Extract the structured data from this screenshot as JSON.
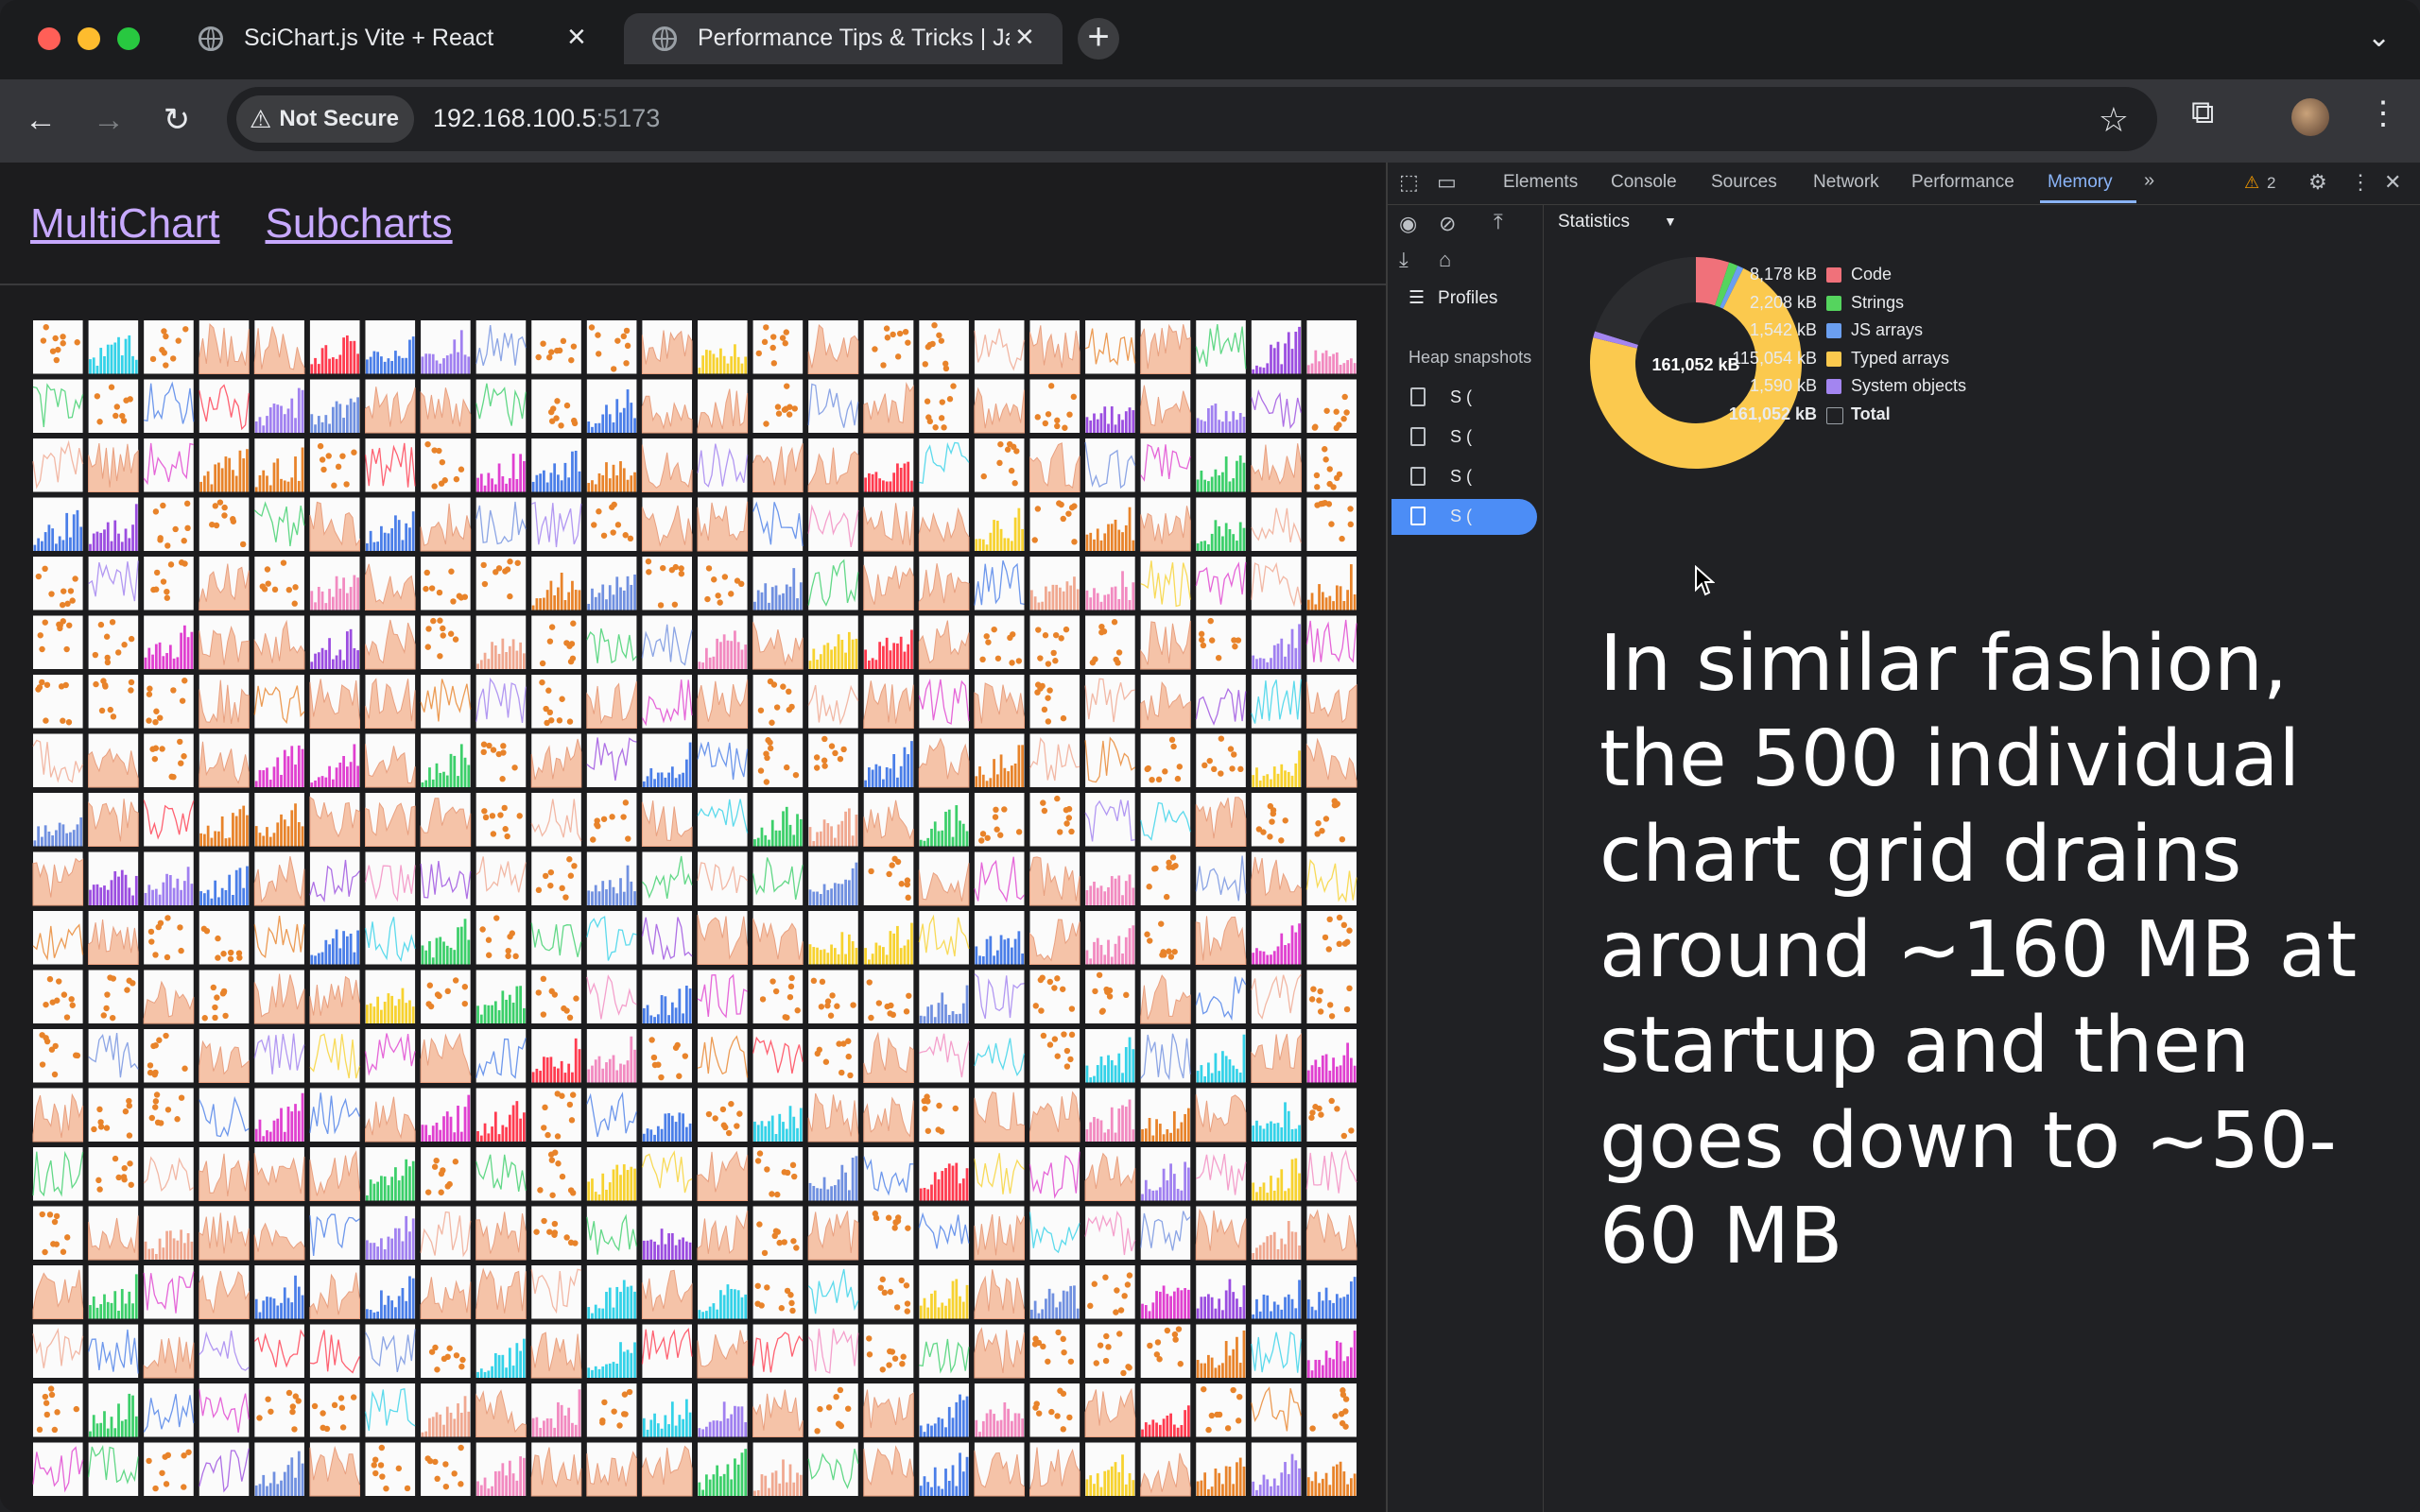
{
  "browser": {
    "tabs": [
      {
        "title": "SciChart.js Vite + React",
        "active": false
      },
      {
        "title": "Performance Tips & Tricks | Ja",
        "active": true
      }
    ],
    "security_chip": "Not Secure",
    "url_host": "192.168.100.5",
    "url_port": ":5173",
    "icons": [
      "back-icon",
      "forward-icon",
      "reload-icon",
      "warning-icon",
      "star-icon",
      "extensions-icon",
      "kebab-icon"
    ]
  },
  "page": {
    "links": [
      "MultiChart",
      "Subcharts"
    ],
    "grid": {
      "columns": 24,
      "rows": 20,
      "chart_types": [
        "bar",
        "line",
        "area",
        "scatter"
      ],
      "palette": [
        "#f7d22f",
        "#f28ac0",
        "#e8832a",
        "#9b4de0",
        "#4a7ee8",
        "#34d2e8",
        "#3ccf6a",
        "#ff3b4f",
        "#e040d0",
        "#f0a890",
        "#a080f0",
        "#7090e0"
      ]
    }
  },
  "devtools": {
    "tabs": [
      "Elements",
      "Console",
      "Sources",
      "Network",
      "Performance",
      "Memory"
    ],
    "active_tab": "Memory",
    "warning_count": "2",
    "sidebar": {
      "profiles_label": "Profiles",
      "heap_label": "Heap snapshots",
      "snapshots": [
        "S (",
        "S (",
        "S (",
        "S ("
      ],
      "selected_snapshot": 3
    },
    "view_select": "Statistics",
    "statistics": [
      {
        "value": "8,178 kB",
        "name": "Code",
        "color": "#f0717a"
      },
      {
        "value": "2,208 kB",
        "name": "Strings",
        "color": "#55d45e"
      },
      {
        "value": "1,542 kB",
        "name": "JS arrays",
        "color": "#6b9ff0"
      },
      {
        "value": "115,054 kB",
        "name": "Typed arrays",
        "color": "#fbc94e"
      },
      {
        "value": "1,590 kB",
        "name": "System objects",
        "color": "#a385f0"
      },
      {
        "value": "161,052 kB",
        "name": "Total",
        "color": ""
      }
    ],
    "donut_center": "161,052 kB"
  },
  "annotation": "In similar fashion, the 500 individual chart grid drains around ~160 MB at startup and then goes down to ~50-60 MB"
}
